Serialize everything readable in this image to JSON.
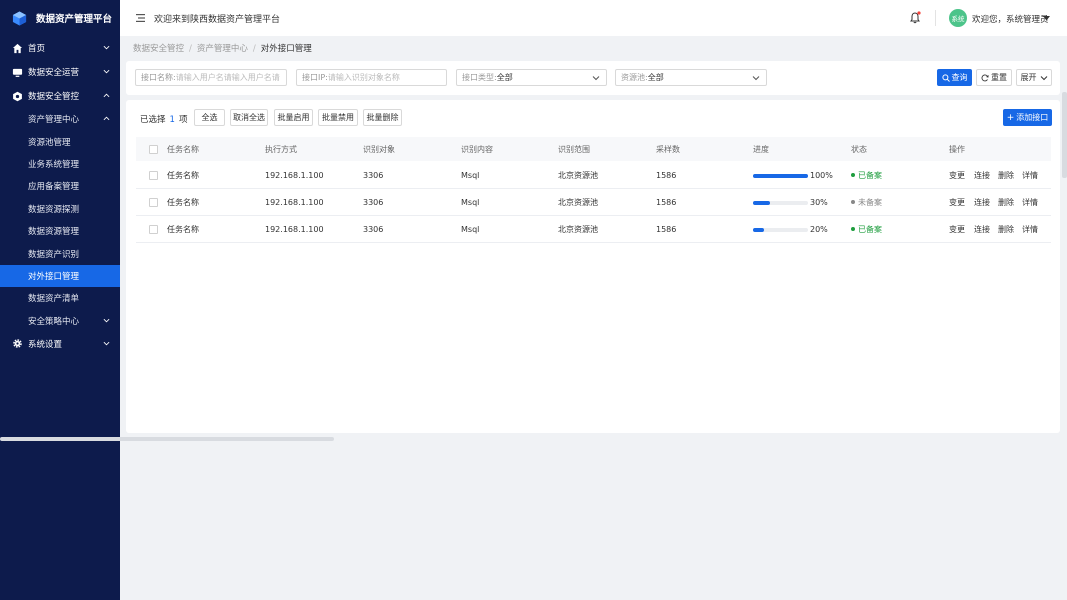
{
  "app": {
    "title": "数据资产管理平台",
    "welcome": "欢迎来到陕西数据资产管理平台"
  },
  "user": {
    "avatar_text": "系统",
    "greeting": "欢迎您，系统管理员"
  },
  "menu": {
    "home": "首页",
    "ops": "数据安全运营",
    "control": "数据安全管控",
    "asset_center": "资产管理中心",
    "sub_items": [
      "资源池管理",
      "业务系统管理",
      "应用备案管理",
      "数据资源探测",
      "数据资源管理",
      "数据资产识别",
      "对外接口管理",
      "数据资产清单"
    ],
    "policy_center": "安全策略中心",
    "settings": "系统设置"
  },
  "breadcrumb": [
    "数据安全管控",
    "资产管理中心",
    "对外接口管理"
  ],
  "filters": {
    "name_label": "接口名称:",
    "name_placeholder": "请输入用户名请输入用户名请",
    "ip_label": "接口IP:",
    "ip_placeholder": "请输入识别对象名称",
    "type_label": "接口类型:",
    "type_value": "全部",
    "pool_label": "资源池:",
    "pool_value": "全部",
    "query": "查询",
    "reset": "重置",
    "expand": "展开"
  },
  "toolbar": {
    "selected_prefix": "已选择",
    "selected_count": "1",
    "selected_suffix": "项",
    "select_all": "全选",
    "cancel_all": "取消全选",
    "batch_enable": "批量启用",
    "batch_disable": "批量禁用",
    "batch_delete": "批量删除",
    "add": "添加接口"
  },
  "table": {
    "columns": [
      "任务名称",
      "执行方式",
      "识别对象",
      "识别内容",
      "识别范围",
      "采样数",
      "进度",
      "状态",
      "操作"
    ],
    "ops": [
      "变更",
      "连接",
      "删除",
      "详情"
    ],
    "rows": [
      {
        "name": "任务名称",
        "mode": "192.168.1.100",
        "target": "3306",
        "content": "Msql",
        "scope": "北京资源池",
        "samples": "1586",
        "progress": 100,
        "progress_text": "100%",
        "status": "已备案",
        "status_color": "#1e9d3e"
      },
      {
        "name": "任务名称",
        "mode": "192.168.1.100",
        "target": "3306",
        "content": "Msql",
        "scope": "北京资源池",
        "samples": "1586",
        "progress": 30,
        "progress_text": "30%",
        "status": "未备案",
        "status_color": "#888888"
      },
      {
        "name": "任务名称",
        "mode": "192.168.1.100",
        "target": "3306",
        "content": "Msql",
        "scope": "北京资源池",
        "samples": "1586",
        "progress": 20,
        "progress_text": "20%",
        "status": "已备案",
        "status_color": "#1e9d3e"
      }
    ]
  },
  "colors": {
    "primary": "#1768e6",
    "sidebar": "#0d1b4c",
    "success": "#1e9d3e"
  }
}
